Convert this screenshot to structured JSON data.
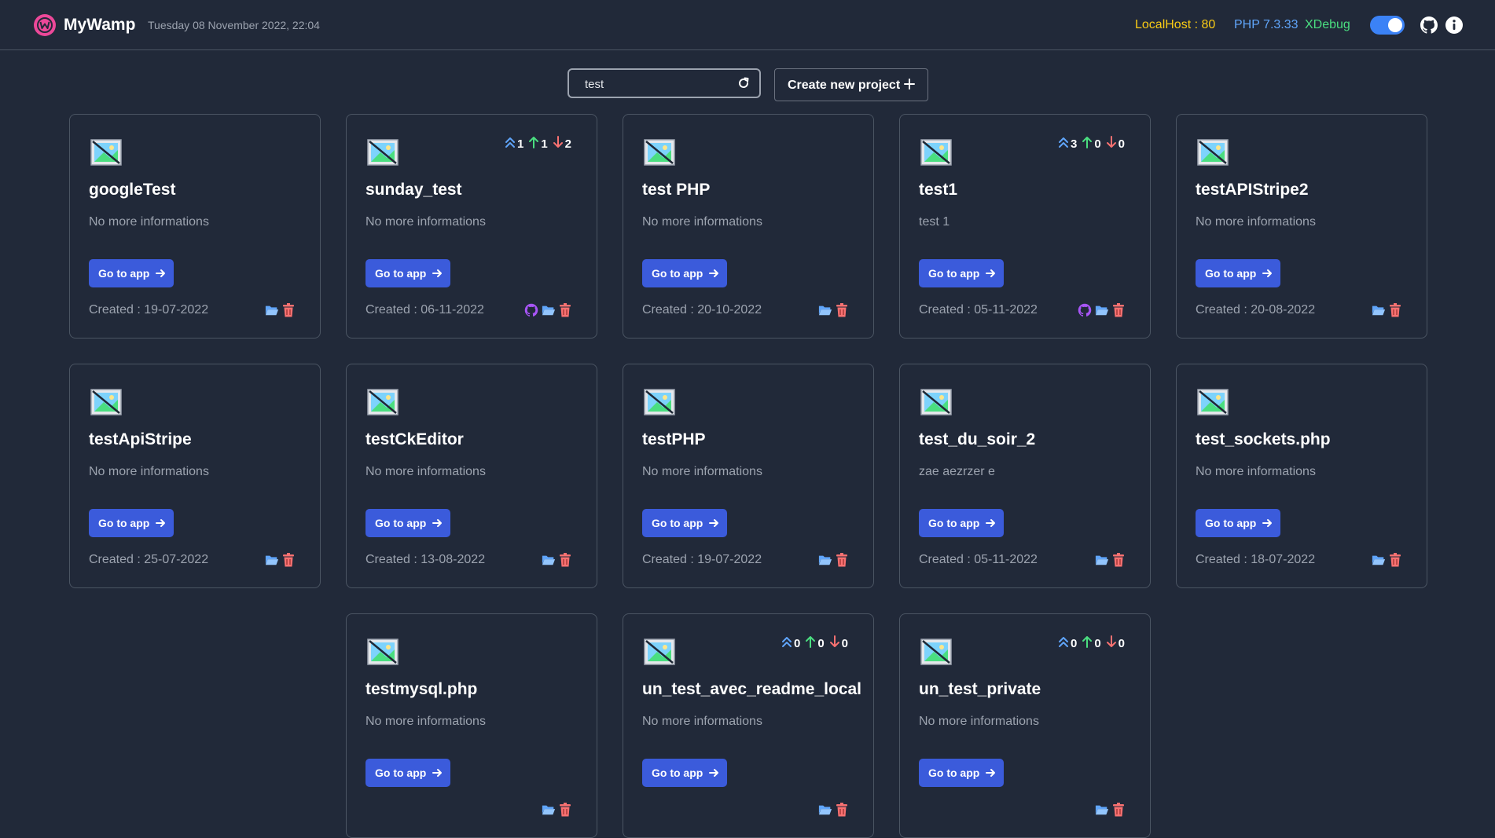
{
  "header": {
    "app_name": "MyWamp",
    "date": "Tuesday 08 November 2022, 22:04",
    "localhost": "LocalHost : 80",
    "php": "PHP 7.3.33",
    "xdebug": "XDebug"
  },
  "toolbar": {
    "search_value": "test",
    "create_label": "Create new project"
  },
  "card_labels": {
    "go": "Go to app"
  },
  "colors": {
    "background": "#212939",
    "accent": "#3b5bdb",
    "localhost": "#facc15",
    "php": "#60a5fa",
    "xdebug": "#4ade80",
    "delete": "#f87171",
    "github": "#a855f7"
  },
  "projects": [
    {
      "title": "googleTest",
      "desc": "No more informations",
      "created": "Created : 19-07-2022"
    },
    {
      "title": "sunday_test",
      "desc": "No more informations",
      "created": "Created : 06-11-2022",
      "github": true,
      "stats": [
        "1",
        "1",
        "2"
      ]
    },
    {
      "title": "test PHP",
      "desc": "No more informations",
      "created": "Created : 20-10-2022"
    },
    {
      "title": "test1",
      "desc": "test 1",
      "created": "Created : 05-11-2022",
      "github": true,
      "stats": [
        "3",
        "0",
        "0"
      ]
    },
    {
      "title": "testAPIStripe2",
      "desc": "No more informations",
      "created": "Created : 20-08-2022"
    },
    {
      "title": "testApiStripe",
      "desc": "No more informations",
      "created": "Created : 25-07-2022"
    },
    {
      "title": "testCkEditor",
      "desc": "No more informations",
      "created": "Created : 13-08-2022"
    },
    {
      "title": "testPHP",
      "desc": "No more informations",
      "created": "Created : 19-07-2022"
    },
    {
      "title": "test_du_soir_2",
      "desc": "zae aezrzer e",
      "created": "Created : 05-11-2022"
    },
    {
      "title": "test_sockets.php",
      "desc": "No more informations",
      "created": "Created : 18-07-2022"
    },
    {
      "title": "testmysql.php",
      "desc": "No more informations",
      "created": ""
    },
    {
      "title": "un_test_avec_readme_local",
      "desc": "No more informations",
      "created": "",
      "stats": [
        "0",
        "0",
        "0"
      ]
    },
    {
      "title": "un_test_private",
      "desc": "No more informations",
      "created": "",
      "stats": [
        "0",
        "0",
        "0"
      ]
    }
  ]
}
